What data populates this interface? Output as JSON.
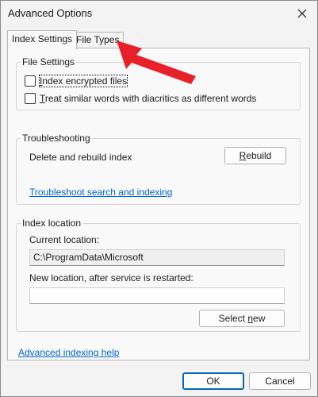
{
  "window": {
    "title": "Advanced Options"
  },
  "tabs": [
    {
      "label": "Index Settings",
      "active": true
    },
    {
      "label": "File Types",
      "active": false
    }
  ],
  "file_settings": {
    "legend": "File Settings",
    "checkboxes": [
      {
        "label_first": "I",
        "label_rest": "ndex encrypted files",
        "checked": false
      },
      {
        "label_first": "T",
        "label_rest": "reat similar words with diacritics as different words",
        "checked": false
      }
    ]
  },
  "troubleshooting": {
    "legend": "Troubleshooting",
    "rebuild_text": "Delete and rebuild index",
    "rebuild_button_first": "R",
    "rebuild_button_rest": "ebuild",
    "troubleshoot_link": "Troubleshoot search and indexing"
  },
  "index_location": {
    "legend": "Index location",
    "current_label": "Current location:",
    "current_value": "C:\\ProgramData\\Microsoft",
    "new_label": "New location, after service is restarted:",
    "new_value": "",
    "select_new_prefix": "Select ",
    "select_new_u": "n",
    "select_new_rest": "ew"
  },
  "help_link": "Advanced indexing help",
  "footer": {
    "ok_label": "OK",
    "cancel_label": "Cancel"
  },
  "annotation": {
    "arrow_color": "#e8202a",
    "icon": "red-arrow"
  }
}
